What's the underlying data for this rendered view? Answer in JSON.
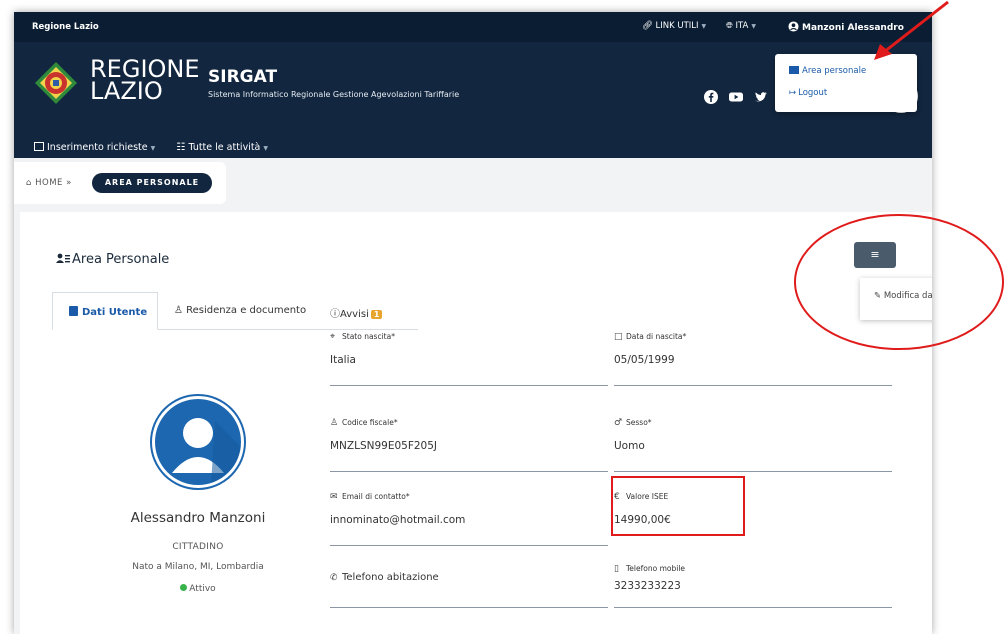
{
  "topbar": {
    "region": "Regione Lazio",
    "links_label": "LINK UTILI",
    "lang_label": "ITA",
    "user_name": "Manzoni Alessandro"
  },
  "header": {
    "brand_line1": "REGIONE",
    "brand_line2": "LAZIO",
    "app_name": "SIRGAT",
    "app_subtitle": "Sistema Informatico Regionale Gestione Agevolazioni Tariffarie",
    "menu": [
      {
        "label": "Inserimento richieste"
      },
      {
        "label": "Tutte le attività"
      }
    ],
    "socials": [
      "facebook-icon",
      "youtube-icon",
      "twitter-icon"
    ]
  },
  "user_dropdown": {
    "area_personale": "Area personale",
    "logout": "Logout"
  },
  "breadcrumb": {
    "home": "HOME",
    "active": "AREA PERSONALE"
  },
  "page": {
    "title": "Area Personale",
    "menu_button": "≡",
    "edit_label": "Modifica dati utente"
  },
  "tabs": [
    {
      "label": "Dati Utente",
      "active": true
    },
    {
      "label": "Residenza e documento",
      "active": false
    },
    {
      "label": "Avvisi",
      "active": false,
      "badge": "1"
    }
  ],
  "profile": {
    "name": "Alessandro Manzoni",
    "role": "CITTADINO",
    "birth": "Nato a Milano, MI, Lombardia",
    "status": "Attivo"
  },
  "fields": {
    "stato_nascita": {
      "label": "Stato nascita*",
      "value": "Italia"
    },
    "data_nascita": {
      "label": "Data di nascita*",
      "value": "05/05/1999"
    },
    "codice_fiscale": {
      "label": "Codice fiscale*",
      "value": "MNZLSN99E05F205J"
    },
    "sesso": {
      "label": "Sesso*",
      "value": "Uomo"
    },
    "email": {
      "label": "Email di contatto*",
      "value": "innominato@hotmail.com"
    },
    "isee": {
      "label": "Valore ISEE",
      "value": "14990,00€"
    },
    "telefono_abitazione": {
      "label": "Telefono abitazione",
      "value": ""
    },
    "telefono_mobile": {
      "label": "Telefono mobile",
      "value": "3233233223"
    }
  },
  "colors": {
    "header": "#12263f",
    "topbar": "#0b1d33",
    "accent": "#1a5aa8",
    "annotation": "#e01b1b",
    "badge": "#e8a52b",
    "status_active": "#38b24a"
  }
}
